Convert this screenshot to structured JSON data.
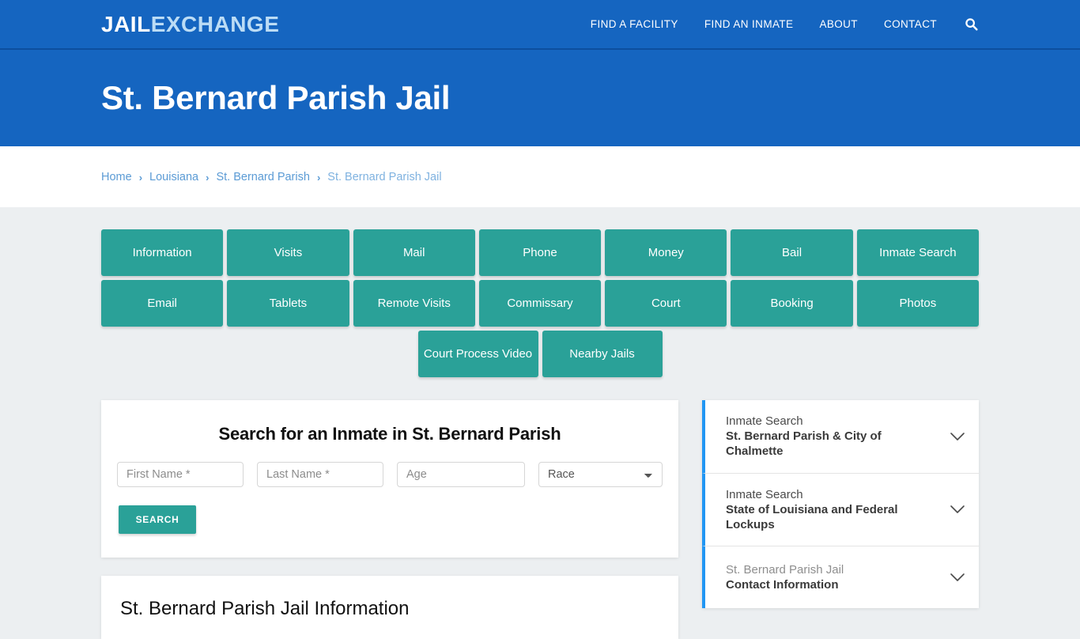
{
  "header": {
    "logo_primary": "JAIL",
    "logo_secondary": "EXCHANGE",
    "nav": [
      {
        "label": "FIND A FACILITY"
      },
      {
        "label": "FIND AN INMATE"
      },
      {
        "label": "ABOUT"
      },
      {
        "label": "CONTACT"
      }
    ],
    "search_icon": "search-icon",
    "brand_color": "#1565c0"
  },
  "hero": {
    "title": "St. Bernard Parish Jail"
  },
  "breadcrumb": {
    "separator": "›",
    "items": [
      {
        "label": "Home"
      },
      {
        "label": "Louisiana"
      },
      {
        "label": "St. Bernard Parish"
      },
      {
        "label": "St. Bernard Parish Jail"
      }
    ]
  },
  "quick_links": {
    "accent_color": "#2aa198",
    "row1": [
      "Information",
      "Visits",
      "Mail",
      "Phone",
      "Money",
      "Bail",
      "Inmate Search"
    ],
    "row2": [
      "Email",
      "Tablets",
      "Remote Visits",
      "Commissary",
      "Court",
      "Booking",
      "Photos"
    ],
    "row3": [
      "Court Process Video",
      "Nearby Jails"
    ]
  },
  "inmate_search": {
    "heading": "Search for an Inmate in St. Bernard Parish",
    "first_name_placeholder": "First Name *",
    "first_name_value": "",
    "last_name_placeholder": "Last Name *",
    "last_name_value": "",
    "age_placeholder": "Age",
    "age_value": "",
    "race_selected": "Race",
    "race_options": [
      "Race"
    ],
    "submit_label": "SEARCH"
  },
  "info_section": {
    "heading": "St. Bernard Parish Jail Information"
  },
  "sidebar": {
    "accent_color": "#2196f3",
    "items": [
      {
        "line1": "Inmate Search",
        "line2": "St. Bernard Parish & City of Chalmette",
        "line1_muted": false
      },
      {
        "line1": "Inmate Search",
        "line2": "State of Louisiana and Federal Lockups",
        "line1_muted": false
      },
      {
        "line1": "St. Bernard Parish Jail",
        "line2": "Contact Information",
        "line1_muted": true
      }
    ]
  }
}
